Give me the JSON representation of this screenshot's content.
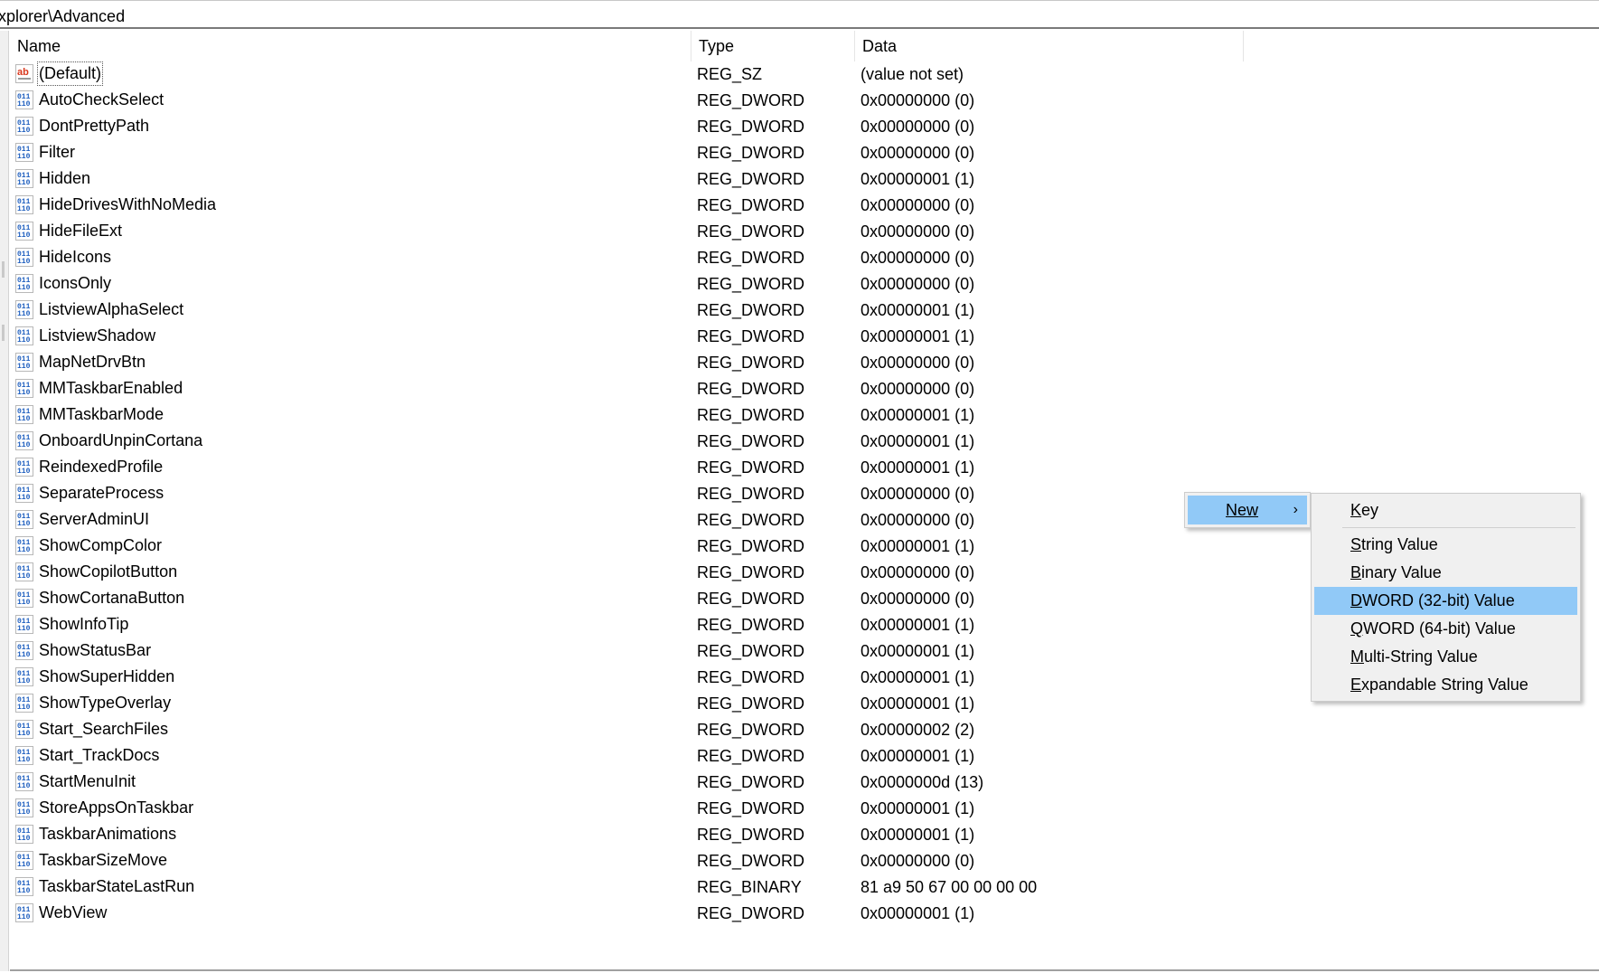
{
  "address": {
    "path": "xplorer\\Advanced"
  },
  "columns": {
    "name": "Name",
    "type": "Type",
    "data": "Data"
  },
  "icons": {
    "string": "string-value-icon",
    "binary": "binary-value-icon"
  },
  "rows": [
    {
      "name": "(Default)",
      "type": "REG_SZ",
      "data": "(value not set)",
      "icon": "string"
    },
    {
      "name": "AutoCheckSelect",
      "type": "REG_DWORD",
      "data": "0x00000000 (0)",
      "icon": "binary"
    },
    {
      "name": "DontPrettyPath",
      "type": "REG_DWORD",
      "data": "0x00000000 (0)",
      "icon": "binary"
    },
    {
      "name": "Filter",
      "type": "REG_DWORD",
      "data": "0x00000000 (0)",
      "icon": "binary"
    },
    {
      "name": "Hidden",
      "type": "REG_DWORD",
      "data": "0x00000001 (1)",
      "icon": "binary"
    },
    {
      "name": "HideDrivesWithNoMedia",
      "type": "REG_DWORD",
      "data": "0x00000000 (0)",
      "icon": "binary"
    },
    {
      "name": "HideFileExt",
      "type": "REG_DWORD",
      "data": "0x00000000 (0)",
      "icon": "binary"
    },
    {
      "name": "HideIcons",
      "type": "REG_DWORD",
      "data": "0x00000000 (0)",
      "icon": "binary"
    },
    {
      "name": "IconsOnly",
      "type": "REG_DWORD",
      "data": "0x00000000 (0)",
      "icon": "binary"
    },
    {
      "name": "ListviewAlphaSelect",
      "type": "REG_DWORD",
      "data": "0x00000001 (1)",
      "icon": "binary"
    },
    {
      "name": "ListviewShadow",
      "type": "REG_DWORD",
      "data": "0x00000001 (1)",
      "icon": "binary"
    },
    {
      "name": "MapNetDrvBtn",
      "type": "REG_DWORD",
      "data": "0x00000000 (0)",
      "icon": "binary"
    },
    {
      "name": "MMTaskbarEnabled",
      "type": "REG_DWORD",
      "data": "0x00000000 (0)",
      "icon": "binary"
    },
    {
      "name": "MMTaskbarMode",
      "type": "REG_DWORD",
      "data": "0x00000001 (1)",
      "icon": "binary"
    },
    {
      "name": "OnboardUnpinCortana",
      "type": "REG_DWORD",
      "data": "0x00000001 (1)",
      "icon": "binary"
    },
    {
      "name": "ReindexedProfile",
      "type": "REG_DWORD",
      "data": "0x00000001 (1)",
      "icon": "binary"
    },
    {
      "name": "SeparateProcess",
      "type": "REG_DWORD",
      "data": "0x00000000 (0)",
      "icon": "binary"
    },
    {
      "name": "ServerAdminUI",
      "type": "REG_DWORD",
      "data": "0x00000000 (0)",
      "icon": "binary"
    },
    {
      "name": "ShowCompColor",
      "type": "REG_DWORD",
      "data": "0x00000001 (1)",
      "icon": "binary"
    },
    {
      "name": "ShowCopilotButton",
      "type": "REG_DWORD",
      "data": "0x00000000 (0)",
      "icon": "binary"
    },
    {
      "name": "ShowCortanaButton",
      "type": "REG_DWORD",
      "data": "0x00000000 (0)",
      "icon": "binary"
    },
    {
      "name": "ShowInfoTip",
      "type": "REG_DWORD",
      "data": "0x00000001 (1)",
      "icon": "binary"
    },
    {
      "name": "ShowStatusBar",
      "type": "REG_DWORD",
      "data": "0x00000001 (1)",
      "icon": "binary"
    },
    {
      "name": "ShowSuperHidden",
      "type": "REG_DWORD",
      "data": "0x00000001 (1)",
      "icon": "binary"
    },
    {
      "name": "ShowTypeOverlay",
      "type": "REG_DWORD",
      "data": "0x00000001 (1)",
      "icon": "binary"
    },
    {
      "name": "Start_SearchFiles",
      "type": "REG_DWORD",
      "data": "0x00000002 (2)",
      "icon": "binary"
    },
    {
      "name": "Start_TrackDocs",
      "type": "REG_DWORD",
      "data": "0x00000001 (1)",
      "icon": "binary"
    },
    {
      "name": "StartMenuInit",
      "type": "REG_DWORD",
      "data": "0x0000000d (13)",
      "icon": "binary"
    },
    {
      "name": "StoreAppsOnTaskbar",
      "type": "REG_DWORD",
      "data": "0x00000001 (1)",
      "icon": "binary"
    },
    {
      "name": "TaskbarAnimations",
      "type": "REG_DWORD",
      "data": "0x00000001 (1)",
      "icon": "binary"
    },
    {
      "name": "TaskbarSizeMove",
      "type": "REG_DWORD",
      "data": "0x00000000 (0)",
      "icon": "binary"
    },
    {
      "name": "TaskbarStateLastRun",
      "type": "REG_BINARY",
      "data": "81 a9 50 67 00 00 00 00",
      "icon": "binary"
    },
    {
      "name": "WebView",
      "type": "REG_DWORD",
      "data": "0x00000001 (1)",
      "icon": "binary"
    }
  ],
  "context_menu": {
    "new_label": "New",
    "arrow": "›",
    "submenu": {
      "key": "Key",
      "string_value": "String Value",
      "binary_value": "Binary Value",
      "dword_value": "DWORD (32-bit) Value",
      "qword_value": "QWORD (64-bit) Value",
      "multi_string_value": "Multi-String Value",
      "expandable_string_value": "Expandable String Value"
    },
    "highlighted": "dword_value"
  },
  "colors": {
    "menu_highlight": "#91c9f7",
    "menu_background": "#f0f0f0",
    "string_icon_red": "#d9381e",
    "binary_icon_blue": "#1f5fbf"
  }
}
